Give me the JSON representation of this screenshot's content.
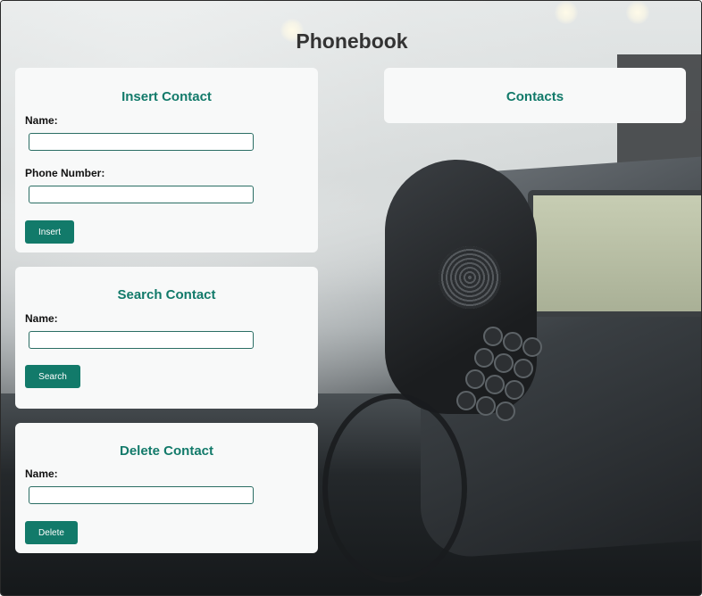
{
  "page": {
    "title": "Phonebook"
  },
  "insert": {
    "heading": "Insert Contact",
    "name_label": "Name:",
    "name_value": "",
    "phone_label": "Phone Number:",
    "phone_value": "",
    "button": "Insert"
  },
  "search": {
    "heading": "Search Contact",
    "name_label": "Name:",
    "name_value": "",
    "button": "Search"
  },
  "delete": {
    "heading": "Delete Contact",
    "name_label": "Name:",
    "name_value": "",
    "button": "Delete"
  },
  "contacts": {
    "heading": "Contacts"
  },
  "colors": {
    "accent": "#127a6a",
    "title": "#333333",
    "card": "#f8f9f9"
  }
}
